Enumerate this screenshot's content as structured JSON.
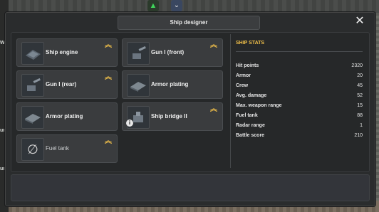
{
  "window": {
    "title": "Ship designer",
    "close_label": "✕"
  },
  "slots": [
    {
      "label": "Ship engine",
      "icon": "engine-icon",
      "upgrade": true
    },
    {
      "label": "Gun I (front)",
      "icon": "gun-icon",
      "upgrade": true
    },
    {
      "label": "Gun I (rear)",
      "icon": "gun-icon",
      "upgrade": true
    },
    {
      "label": "Armor plating",
      "icon": "armor-icon",
      "upgrade": false
    },
    {
      "label": "Armor plating",
      "icon": "armor-icon",
      "upgrade": false
    },
    {
      "label": "Ship bridge II",
      "icon": "bridge-icon",
      "upgrade": true,
      "info": true
    },
    {
      "label": "Fuel tank",
      "icon": "empty-slot-icon",
      "upgrade": true
    }
  ],
  "stats": {
    "title": "SHIP STATS",
    "rows": [
      {
        "label": "Hit points",
        "value": "2320"
      },
      {
        "label": "Armor",
        "value": "20"
      },
      {
        "label": "Crew",
        "value": "45"
      },
      {
        "label": "Avg. damage",
        "value": "52"
      },
      {
        "label": "Max. weapon range",
        "value": "15"
      },
      {
        "label": "Fuel tank",
        "value": "88"
      },
      {
        "label": "Radar range",
        "value": "1"
      },
      {
        "label": "Battle score",
        "value": "210"
      }
    ]
  },
  "background": {
    "left_labels": [
      "W",
      "um",
      "um"
    ],
    "top_buttons": [
      "wifi-icon",
      "chevron-down-icon"
    ]
  },
  "colors": {
    "accent": "#f2c14a",
    "panel": "#2a2c2d",
    "slot": "#3a3c3e"
  }
}
